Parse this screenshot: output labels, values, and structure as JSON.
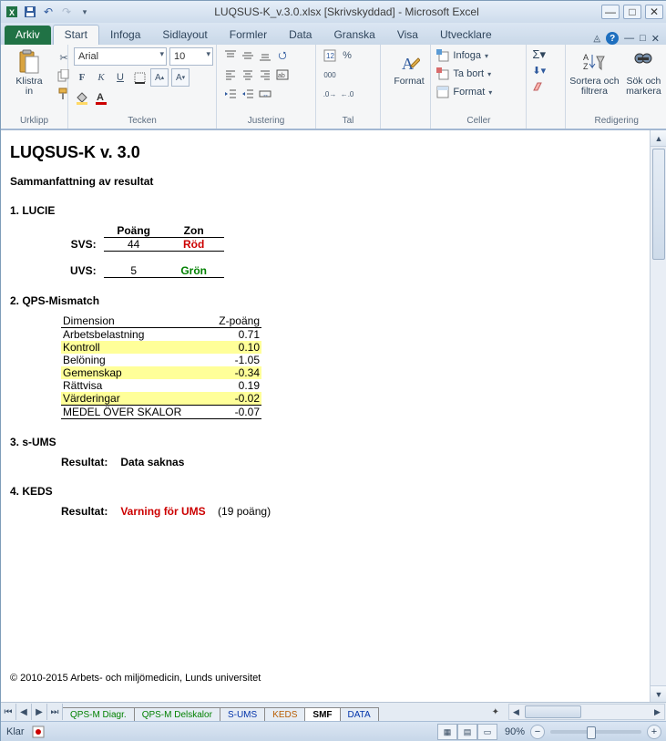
{
  "titlebar": {
    "title": "LUQSUS-K_v.3.0.xlsx  [Skrivskyddad]  -  Microsoft Excel"
  },
  "tabs": {
    "file": "Arkiv",
    "items": [
      "Start",
      "Infoga",
      "Sidlayout",
      "Formler",
      "Data",
      "Granska",
      "Visa",
      "Utvecklare"
    ],
    "active": 0
  },
  "ribbon": {
    "clipboard": {
      "label": "Urklipp",
      "paste": "Klistra\nin"
    },
    "font": {
      "label": "Tecken",
      "name": "Arial",
      "size": "10"
    },
    "align": {
      "label": "Justering"
    },
    "number": {
      "label": "Tal"
    },
    "format_btn": {
      "label": "Format"
    },
    "cells": {
      "label": "Celler",
      "insert": "Infoga",
      "delete": "Ta bort",
      "format": "Format"
    },
    "editing": {
      "label": "Redigering",
      "sort": "Sortera och\nfiltrera",
      "find": "Sök och\nmarkera"
    }
  },
  "sheet": {
    "title": "LUQSUS-K  v. 3.0",
    "summary": "Sammanfattning av resultat",
    "s1": {
      "title": "1. LUCIE",
      "h_score": "Poäng",
      "h_zone": "Zon",
      "rows": [
        {
          "lbl": "SVS:",
          "score": "44",
          "zone": "Röd",
          "cls": "zred"
        },
        {
          "lbl": "UVS:",
          "score": "5",
          "zone": "Grön",
          "cls": "zgreen"
        }
      ]
    },
    "s2": {
      "title": "2. QPS-Mismatch",
      "h_dim": "Dimension",
      "h_z": "Z-poäng",
      "rows": [
        {
          "d": "Arbetsbelastning",
          "z": "0.71",
          "hl": false
        },
        {
          "d": "Kontroll",
          "z": "0.10",
          "hl": true
        },
        {
          "d": "Belöning",
          "z": "-1.05",
          "hl": false
        },
        {
          "d": "Gemenskap",
          "z": "-0.34",
          "hl": true
        },
        {
          "d": "Rättvisa",
          "z": "0.19",
          "hl": false
        },
        {
          "d": "Värderingar",
          "z": "-0.02",
          "hl": true
        }
      ],
      "sum": {
        "d": "MEDEL ÖVER SKALOR",
        "z": "-0.07"
      }
    },
    "s3": {
      "title": "3. s-UMS",
      "lbl": "Resultat:",
      "val": "Data saknas"
    },
    "s4": {
      "title": "4. KEDS",
      "lbl": "Resultat:",
      "val": "Varning för UMS",
      "extra": "(19 poäng)"
    },
    "copyright": "© 2010-2015 Arbets- och miljömedicin, Lunds universitet"
  },
  "sheettabs": [
    "QPS-M Diagr.",
    "QPS-M Delskalor",
    "S-UMS",
    "KEDS",
    "SMF",
    "DATA"
  ],
  "sheettab_active": 4,
  "status": {
    "ready": "Klar",
    "zoom": "90%"
  }
}
